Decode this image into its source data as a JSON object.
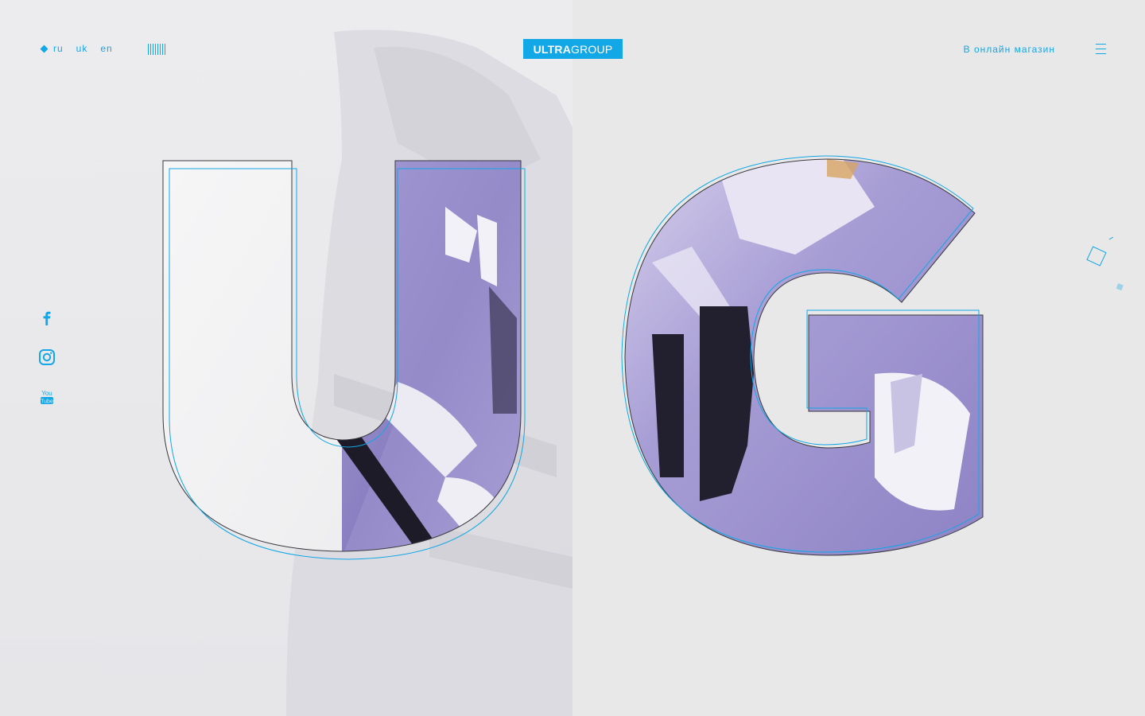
{
  "header": {
    "languages": [
      "ru",
      "uk",
      "en"
    ],
    "active_language": "ru",
    "logo_bold": "ULTRA",
    "logo_light": "GROUP",
    "shop_link": "В онлайн магазин"
  },
  "hero": {
    "letter_left": "U",
    "letter_right": "G"
  },
  "social": {
    "items": [
      "facebook-icon",
      "instagram-icon",
      "youtube-icon"
    ]
  },
  "colors": {
    "accent": "#12a7e6",
    "background": "#e9e9ea",
    "photo_purple": "#8a7fc0"
  }
}
